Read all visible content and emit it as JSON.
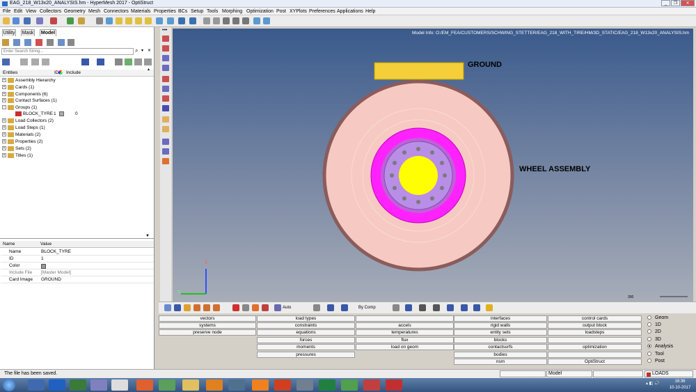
{
  "window": {
    "title": "EAG_218_W13x20_ANALYSIS.hm - HyperMesh 2017 - OptiStruct",
    "buttons": [
      "_",
      "❐",
      "✕"
    ]
  },
  "menu": [
    "File",
    "Edit",
    "View",
    "Collectors",
    "Geometry",
    "Mesh",
    "Connectors",
    "Materials",
    "Properties",
    "BCs",
    "Setup",
    "Tools",
    "Morphing",
    "Optimization",
    "Post",
    "XYPlots",
    "Preferences",
    "Applications",
    "Help"
  ],
  "tabs": [
    "Utility",
    "Mask",
    "Model"
  ],
  "search": {
    "placeholder": "Enter Search String..."
  },
  "entities_header": {
    "entities": "Entities",
    "id": "ID",
    "include": "Include"
  },
  "tree": [
    {
      "label": "Assembly Hierarchy"
    },
    {
      "label": "Cards (1)"
    },
    {
      "label": "Components (6)"
    },
    {
      "label": "Contact Surfaces (1)"
    },
    {
      "label": "Groups (1)"
    },
    {
      "label": "BLOCK_TYRE",
      "id": "1",
      "include": "0"
    },
    {
      "label": "Load Collectors (2)"
    },
    {
      "label": "Load Steps (1)"
    },
    {
      "label": "Materials (2)"
    },
    {
      "label": "Properties (2)"
    },
    {
      "label": "Sets (2)"
    },
    {
      "label": "Titles (1)"
    }
  ],
  "props_header": {
    "name": "Name",
    "value": "Value"
  },
  "props": [
    {
      "name": "Name",
      "value": "BLOCK_TYRE"
    },
    {
      "name": "ID",
      "value": "1"
    },
    {
      "name": "Color",
      "value": ""
    },
    {
      "name": "Include File",
      "value": "[Master Model]"
    },
    {
      "name": "Card Image",
      "value": "GROUND"
    }
  ],
  "viewport": {
    "model_info": "Model Info: O:/EM_FEA/CUSTOMERS/SCHWING_STETTER/EAG_218_WITH_TIRE/HM/3D_STATIC/EAG_218_W13x20_ANALYSIS.hm",
    "label_ground": "GROUND",
    "label_wheel": "WHEEL ASSEMBLY",
    "axis_z": "Z",
    "axis_y": "Y",
    "scale": "300"
  },
  "bottom_toolbar": {
    "auto": "Auto",
    "by_comp": "By Comp"
  },
  "panel": {
    "col1": [
      "vectors",
      "systems",
      "preserve node"
    ],
    "col2": [
      "load types",
      "constraints",
      "equations",
      "forces",
      "moments",
      "pressures"
    ],
    "col3": [
      "",
      "accels",
      "temperatures",
      "flux",
      "load on geom"
    ],
    "col4": [
      "interfaces",
      "rigid walls",
      "entity sets",
      "blocks",
      "contactsurfs",
      "bodies",
      "nsm"
    ],
    "col5": [
      "control cards",
      "output block",
      "loadsteps",
      "",
      "optimization",
      "",
      "OptiStruct"
    ],
    "radios": [
      "Geom",
      "1D",
      "2D",
      "3D",
      "Analysis",
      "Tool",
      "Post"
    ],
    "selected_radio": "Analysis"
  },
  "status": {
    "message": "The file has been saved.",
    "model": "Model",
    "collector": "LOADS"
  },
  "taskbar": {
    "time": "16:36",
    "date": "10-10-2017"
  },
  "colors": {
    "ground": "#f5cf3a",
    "tire": "#f6c9c2",
    "rim": "#ff22ff",
    "disc": "#b88ee6",
    "hub": "#ffff00"
  }
}
